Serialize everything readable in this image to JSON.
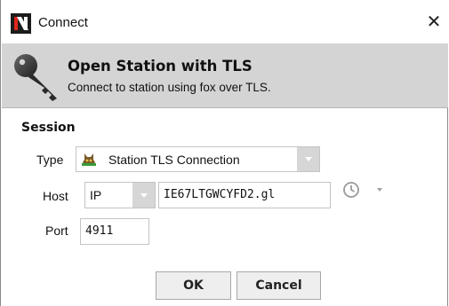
{
  "window": {
    "title": "Connect",
    "close_glyph": "✕",
    "logo_icon": "niagara-n-icon"
  },
  "banner": {
    "icon": "key-icon",
    "title": "Open Station with TLS",
    "subtitle": "Connect to station using fox over TLS."
  },
  "session": {
    "heading": "Session",
    "type": {
      "label": "Type",
      "icon": "station-icon",
      "selected": "Station TLS Connection"
    },
    "host": {
      "label": "Host",
      "protocol_selected": "IP",
      "value": "IE67LTGWCYFD2.gl",
      "history_icon": "history-clock-icon"
    },
    "port": {
      "label": "Port",
      "value": "4911"
    }
  },
  "buttons": {
    "ok_label": "OK",
    "cancel_label": "Cancel"
  },
  "colors": {
    "banner_bg": "#d4d4d4",
    "combo_arrow_bg": "#d6d6d6",
    "logo_red": "#e1251b"
  }
}
